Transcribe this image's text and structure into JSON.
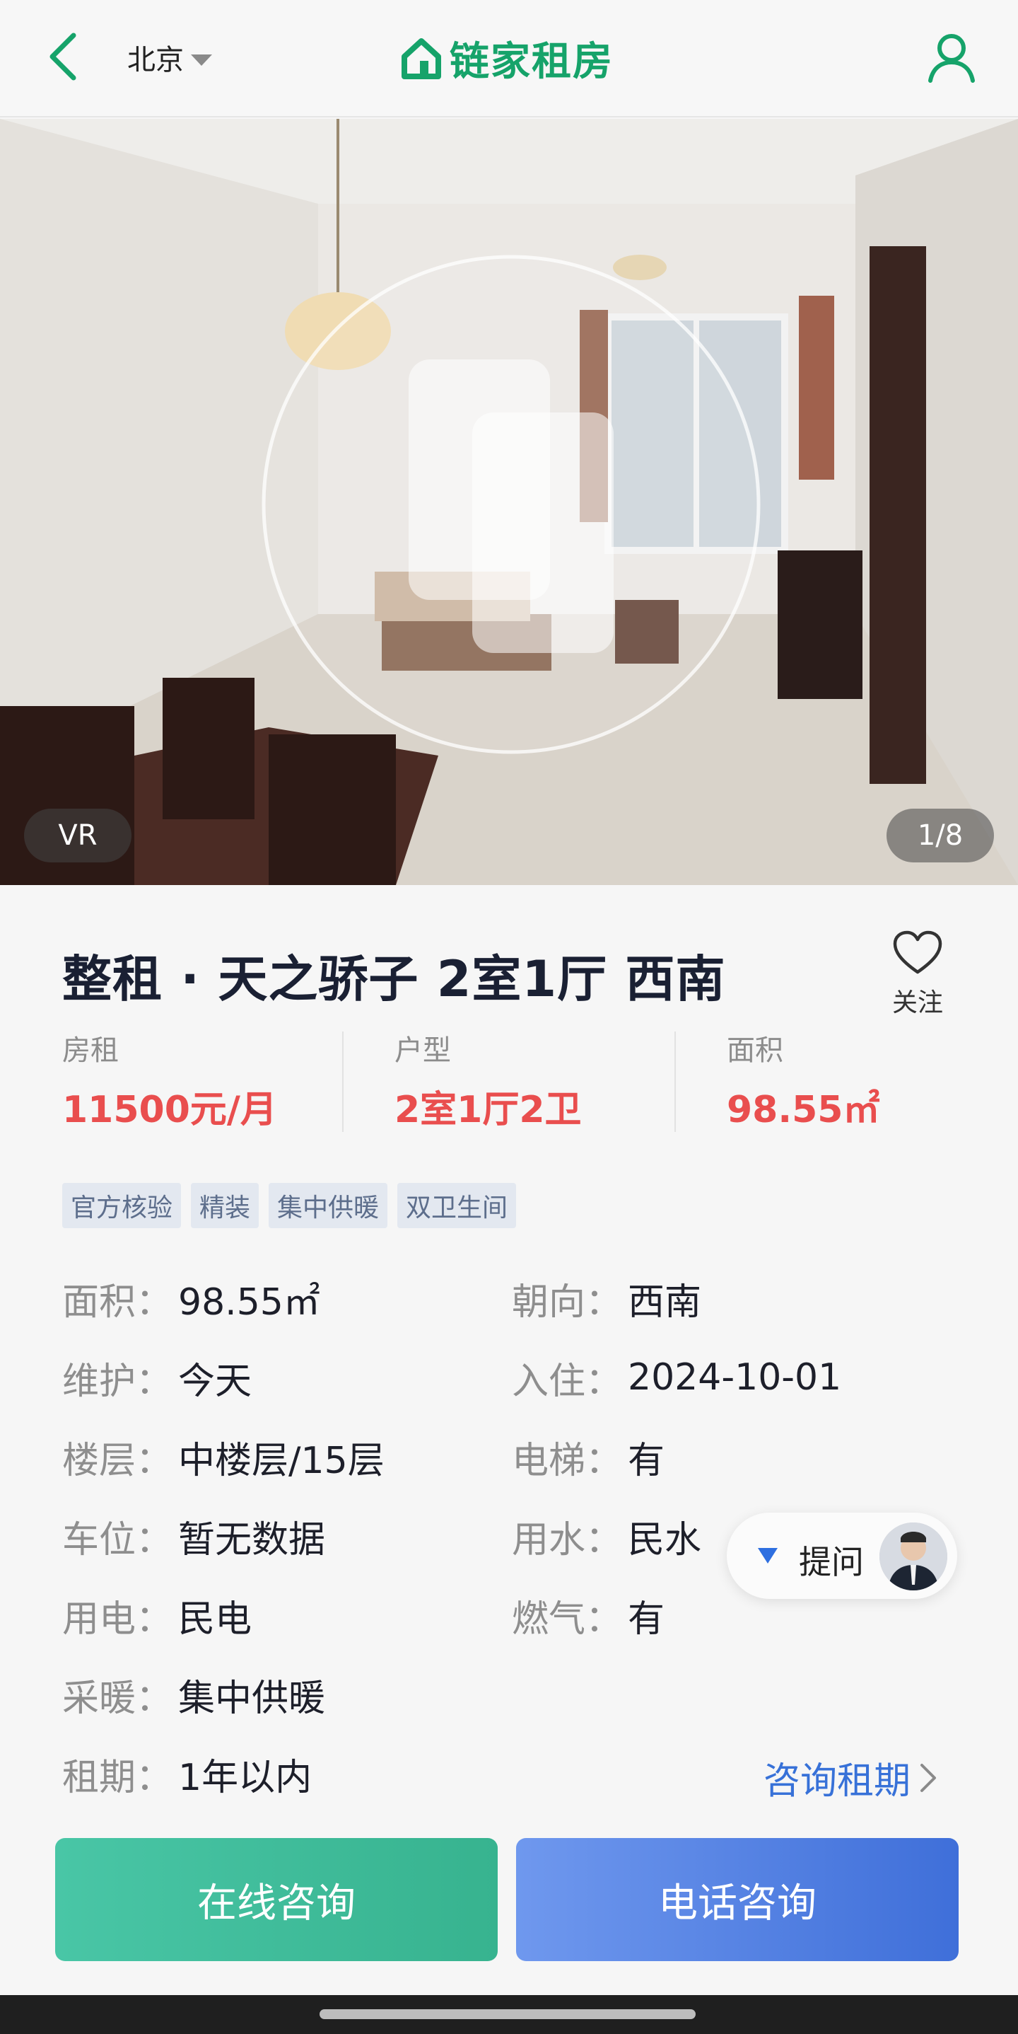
{
  "header": {
    "city": "北京",
    "brand": "链家租房",
    "icons": {
      "back": "chevron-left-icon",
      "user": "user-icon",
      "brand_logo": "house-icon",
      "city_caret": "caret-down-icon"
    },
    "brand_color": "#16a36a"
  },
  "hero": {
    "vr_badge": "VR",
    "image_counter": "1/8",
    "vr_icon": "vr-play-icon"
  },
  "listing": {
    "title": "整租 · 天之骄子 2室1厅 西南",
    "follow_label": "关注",
    "follow_icon": "heart-icon",
    "summary": [
      {
        "label": "房租",
        "value": "11500元/月"
      },
      {
        "label": "户型",
        "value": "2室1厅2卫"
      },
      {
        "label": "面积",
        "value": "98.55㎡"
      }
    ],
    "tags": [
      "官方核验",
      "精装",
      "集中供暖",
      "双卫生间"
    ],
    "attributes": [
      {
        "key": "面积：",
        "value": "98.55㎡"
      },
      {
        "key": "朝向：",
        "value": "西南"
      },
      {
        "key": "维护：",
        "value": "今天"
      },
      {
        "key": "入住：",
        "value": "2024-10-01"
      },
      {
        "key": "楼层：",
        "value": "中楼层/15层"
      },
      {
        "key": "电梯：",
        "value": "有"
      },
      {
        "key": "车位：",
        "value": "暂无数据"
      },
      {
        "key": "用水：",
        "value": "民水"
      },
      {
        "key": "用电：",
        "value": "民电"
      },
      {
        "key": "燃气：",
        "value": "有"
      },
      {
        "key": "采暖：",
        "value": "集中供暖"
      },
      {
        "key": "租期：",
        "value": "1年以内"
      }
    ],
    "consult_term_link": "咨询租期",
    "price_color": "#e94e4e",
    "link_color": "#3771d8"
  },
  "ask": {
    "label": "提问"
  },
  "actions": {
    "online": "在线咨询",
    "phone": "电话咨询"
  }
}
